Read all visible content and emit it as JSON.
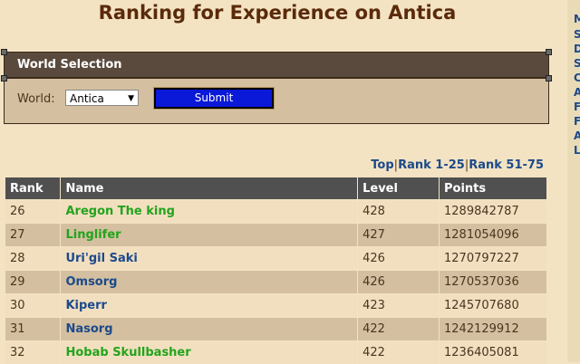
{
  "page": {
    "title": "Ranking for Experience on Antica"
  },
  "right_column": {
    "letters": [
      "M",
      "S",
      "D",
      "S",
      "C",
      "A",
      "F",
      "F",
      "A",
      "L"
    ]
  },
  "world_selection": {
    "header": "World Selection",
    "label": "World:",
    "selected": "Antica",
    "submit_label": "Submit"
  },
  "rank_nav": {
    "top": "Top",
    "prev": "Rank 1-25",
    "next": "Rank 51-75",
    "separator": "|"
  },
  "table": {
    "headers": [
      "Rank",
      "Name",
      "Level",
      "Points"
    ],
    "rows": [
      {
        "rank": "26",
        "name": "Aregon The king",
        "level": "428",
        "points": "1289842787",
        "name_color": "green"
      },
      {
        "rank": "27",
        "name": "Linglifer",
        "level": "427",
        "points": "1281054096",
        "name_color": "green"
      },
      {
        "rank": "28",
        "name": "Uri'gil Saki",
        "level": "426",
        "points": "1270797227",
        "name_color": "blue"
      },
      {
        "rank": "29",
        "name": "Omsorg",
        "level": "426",
        "points": "1270537036",
        "name_color": "blue"
      },
      {
        "rank": "30",
        "name": "Kiperr",
        "level": "423",
        "points": "1245707680",
        "name_color": "blue"
      },
      {
        "rank": "31",
        "name": "Nasorg",
        "level": "422",
        "points": "1242129912",
        "name_color": "blue"
      },
      {
        "rank": "32",
        "name": "Hobab Skullbasher",
        "level": "422",
        "points": "1236405081",
        "name_color": "green"
      }
    ]
  },
  "colors": {
    "background": "#f3e3c3",
    "title": "#5a2a0a",
    "link_blue": "#1c4a8a",
    "online_green": "#22a41b",
    "header_bar": "#505050",
    "submit_blue": "#0a18d8"
  }
}
